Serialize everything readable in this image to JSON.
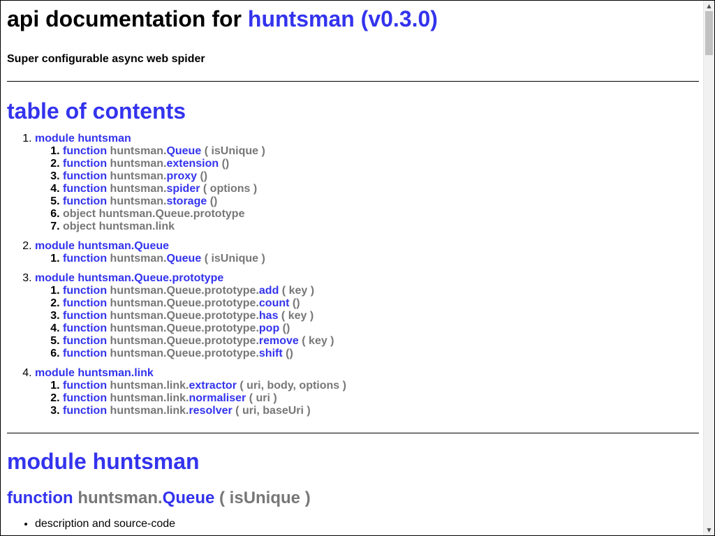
{
  "header": {
    "title_prefix": "api documentation for",
    "title_link": "huntsman (v0.3.0)",
    "description": "Super configurable async web spider"
  },
  "toc": {
    "title": "table of contents",
    "modules": [
      {
        "label": "module huntsman",
        "items": [
          {
            "kind": "function",
            "prefix": "huntsman.",
            "name": "Queue",
            "args": "( isUnique )"
          },
          {
            "kind": "function",
            "prefix": "huntsman.",
            "name": "extension",
            "args": "()"
          },
          {
            "kind": "function",
            "prefix": "huntsman.",
            "name": "proxy",
            "args": "()"
          },
          {
            "kind": "function",
            "prefix": "huntsman.",
            "name": "spider",
            "args": "( options )"
          },
          {
            "kind": "function",
            "prefix": "huntsman.",
            "name": "storage",
            "args": "()"
          },
          {
            "kind": "object",
            "text": "object huntsman.Queue.prototype"
          },
          {
            "kind": "object",
            "text": "object huntsman.link"
          }
        ]
      },
      {
        "label": "module huntsman.Queue",
        "items": [
          {
            "kind": "function",
            "prefix": "huntsman.",
            "name": "Queue",
            "args": "( isUnique )"
          }
        ]
      },
      {
        "label": "module huntsman.Queue.prototype",
        "items": [
          {
            "kind": "function",
            "prefix": "huntsman.Queue.prototype.",
            "name": "add",
            "args": "( key )"
          },
          {
            "kind": "function",
            "prefix": "huntsman.Queue.prototype.",
            "name": "count",
            "args": "()"
          },
          {
            "kind": "function",
            "prefix": "huntsman.Queue.prototype.",
            "name": "has",
            "args": "( key )"
          },
          {
            "kind": "function",
            "prefix": "huntsman.Queue.prototype.",
            "name": "pop",
            "args": "()"
          },
          {
            "kind": "function",
            "prefix": "huntsman.Queue.prototype.",
            "name": "remove",
            "args": "( key )"
          },
          {
            "kind": "function",
            "prefix": "huntsman.Queue.prototype.",
            "name": "shift",
            "args": "()"
          }
        ]
      },
      {
        "label": "module huntsman.link",
        "items": [
          {
            "kind": "function",
            "prefix": "huntsman.link.",
            "name": "extractor",
            "args": "( uri, body, options )"
          },
          {
            "kind": "function",
            "prefix": "huntsman.link.",
            "name": "normaliser",
            "args": "( uri )"
          },
          {
            "kind": "function",
            "prefix": "huntsman.link.",
            "name": "resolver",
            "args": "( uri, baseUri )"
          }
        ]
      }
    ]
  },
  "section": {
    "title": "module huntsman",
    "function_keyword": "function",
    "function_prefix": "huntsman.",
    "function_name": "Queue",
    "function_args": "( isUnique )",
    "bullet": "description and source-code"
  },
  "labels": {
    "function_keyword": "function"
  },
  "scrollbar": {
    "up_icon": "scroll-up-arrow-icon",
    "down_icon": "scroll-down-arrow-icon"
  },
  "colors": {
    "link": "#3333ee",
    "muted": "#777777",
    "text": "#000000"
  }
}
